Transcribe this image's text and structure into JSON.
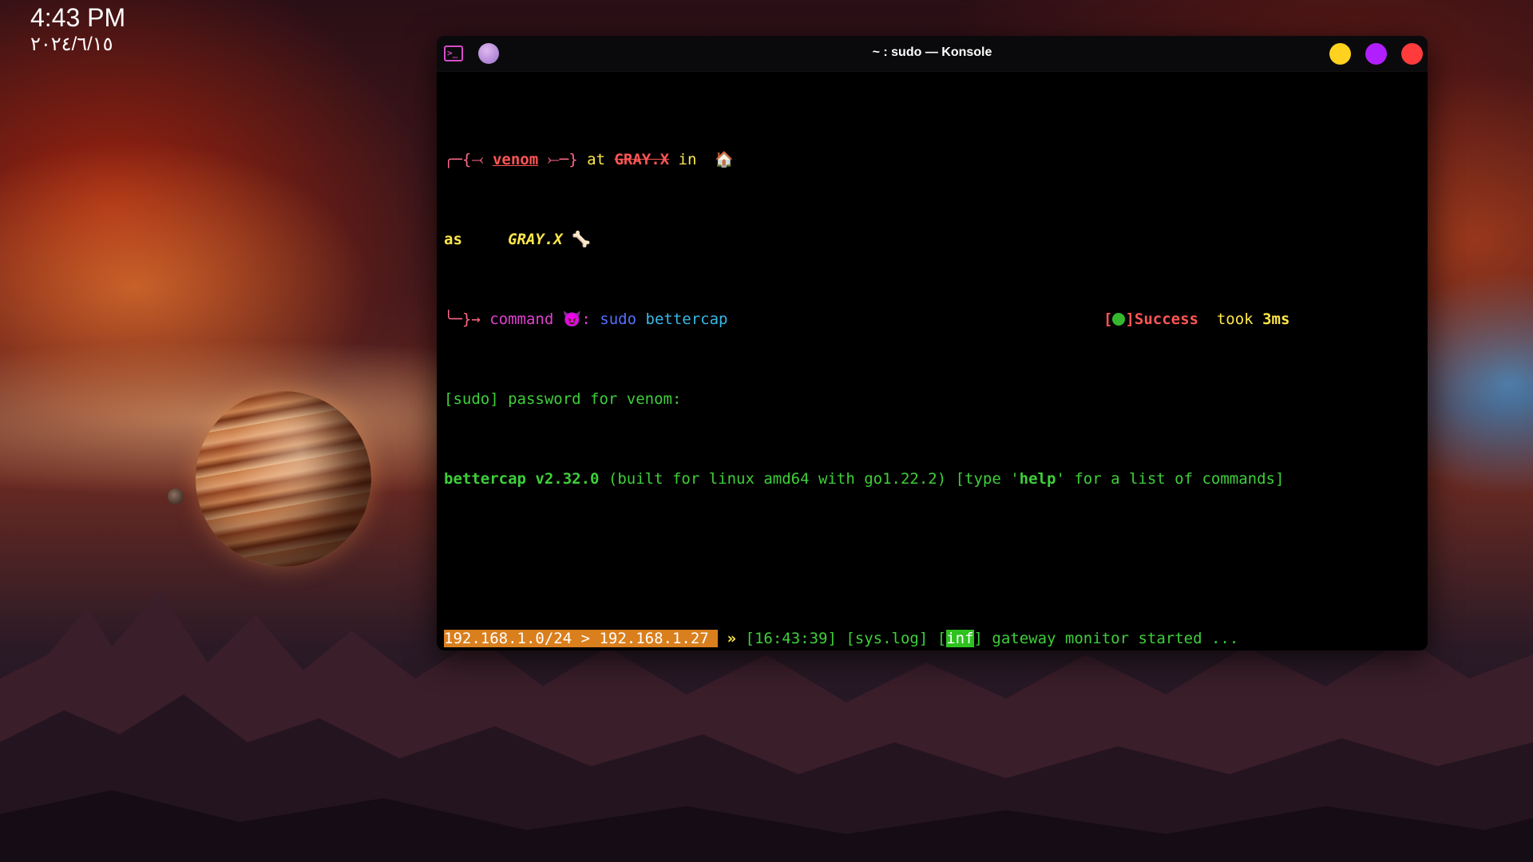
{
  "desktop": {
    "time": "4:43 PM",
    "date": "٢٠٢٤/٦/١٥"
  },
  "window": {
    "title": "~ : sudo — Konsole",
    "app_icon": "terminal-icon",
    "pin_icon": "pin-icon",
    "buttons": {
      "minimize_color": "#ffd21f",
      "maximize_color": "#b11fff",
      "close_color": "#ff3b3b"
    }
  },
  "terminal": {
    "prompt": {
      "l1_prefix": "╭─{⤙ ",
      "user": "venom",
      "l1_mid": " ⤚─}",
      "at": " at ",
      "host": "GRAY.X",
      "in": " in ",
      "home_icon": "🏠",
      "l2_as": "as",
      "l2_host": "GRAY.X",
      "l2_icon": "🦴",
      "l3_prefix": "╰─}→ ",
      "command_word": "command",
      "devil_icon": "😈",
      "colon": ": ",
      "cmd_sudo": "sudo",
      "cmd_arg": " bettercap",
      "status_open": "[",
      "status_close": "]",
      "status_text": "Success",
      "took": "  took ",
      "duration": "3ms"
    },
    "sudo_line": "[sudo] password for venom:",
    "bettercap": {
      "version": "bettercap v2.32.0",
      "built": " (built for linux amd64 with go1.22.2) [type '",
      "help": "help",
      "help_tail": "' for a list of commands]"
    },
    "session_prompt": "192.168.1.0/24 > 192.168.1.27 ",
    "arrow": "»",
    "log": {
      "time": " [16:43:39] ",
      "tag": "[sys.log]",
      "sp": " [",
      "level": "inf",
      "close": "] ",
      "message": "gateway monitor started ..."
    }
  }
}
